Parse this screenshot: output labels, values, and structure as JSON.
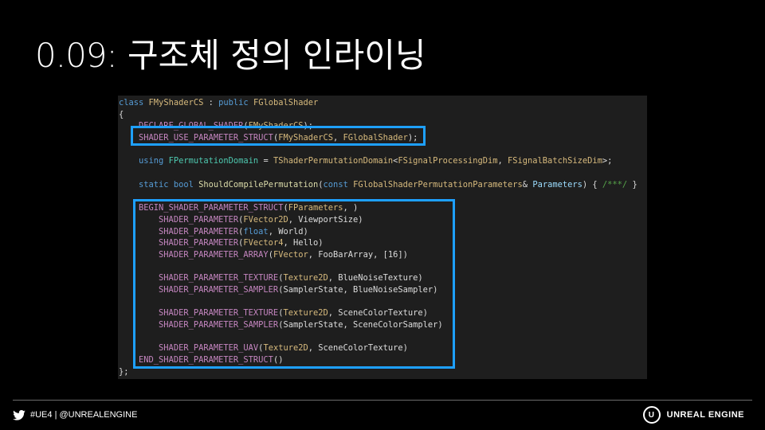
{
  "slide": {
    "title_number": "0.09:",
    "title_text": "구조체 정의 인라이닝"
  },
  "code_lines": [
    "class FMyShaderCS : public FGlobalShader",
    "{",
    "    DECLARE_GLOBAL_SHADER(FMyShaderCS);",
    "    SHADER_USE_PARAMETER_STRUCT(FMyShaderCS, FGlobalShader);",
    "",
    "    using FPermutationDomain = TShaderPermutationDomain<FSignalProcessingDim, FSignalBatchSizeDim>;",
    "",
    "    static bool ShouldCompilePermutation(const FGlobalShaderPermutationParameters& Parameters) { /***/ }",
    "",
    "    BEGIN_SHADER_PARAMETER_STRUCT(FParameters, )",
    "        SHADER_PARAMETER(FVector2D, ViewportSize)",
    "        SHADER_PARAMETER(float, World)",
    "        SHADER_PARAMETER(FVector4, Hello)",
    "        SHADER_PARAMETER_ARRAY(FVector, FooBarArray, [16])",
    "",
    "        SHADER_PARAMETER_TEXTURE(Texture2D, BlueNoiseTexture)",
    "        SHADER_PARAMETER_SAMPLER(SamplerState, BlueNoiseSampler)",
    "",
    "        SHADER_PARAMETER_TEXTURE(Texture2D, SceneColorTexture)",
    "        SHADER_PARAMETER_SAMPLER(SamplerState, SceneColorSampler)",
    "",
    "        SHADER_PARAMETER_UAV(Texture2D, SceneColorTexture)",
    "    END_SHADER_PARAMETER_STRUCT()",
    "};"
  ],
  "footer": {
    "handle": "#UE4 | @UNREALENGINE",
    "brand": "UNREAL ENGINE",
    "logo_letter": "U"
  },
  "colors": {
    "highlight": "#1ea0ff",
    "code_bg": "#1e1e1e"
  },
  "icons": [
    "twitter-bird-icon",
    "unreal-logo-icon"
  ]
}
